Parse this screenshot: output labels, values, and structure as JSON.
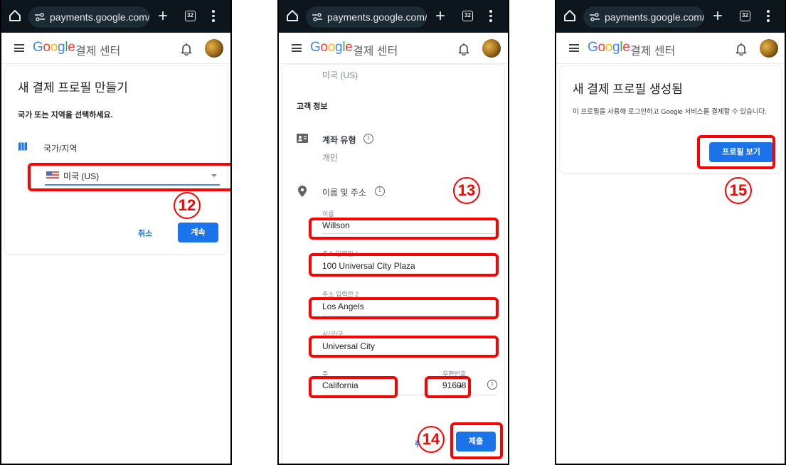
{
  "browser": {
    "url": "payments.google.com/g",
    "tab_count": "32",
    "icons": [
      "home-icon",
      "site-settings-icon",
      "new-tab-icon",
      "tab-switcher-icon",
      "more-menu-icon"
    ]
  },
  "app_header": {
    "logo_letters": [
      "G",
      "o",
      "o",
      "g",
      "l",
      "e"
    ],
    "logo_colors": [
      "#4285f4",
      "#ea4335",
      "#fbbc05",
      "#4285f4",
      "#34a853",
      "#ea4335"
    ],
    "subtitle": "결제 센터",
    "icons": [
      "menu-icon",
      "notifications-bell-icon",
      "account-avatar"
    ]
  },
  "panel1": {
    "title": "새 결제 프로필 만들기",
    "subtitle": "국가 또는 지역을 선택하세요.",
    "country_label": "국가/지역",
    "country_value": "미국 (US)",
    "cancel_label": "취소",
    "continue_label": "계속",
    "step_number": "12"
  },
  "panel2": {
    "country_value": "미국 (US)",
    "section_title": "고객 정보",
    "account_type_label": "계좌 유형",
    "account_type_value": "개인",
    "name_address_label": "이름 및 주소",
    "fields": {
      "name": {
        "label": "이름",
        "value": "Willson"
      },
      "address1": {
        "label": "주소 입력란 1",
        "value": "100 Universal City Plaza"
      },
      "address2": {
        "label": "주소 입력란 2",
        "value": "Los Angels"
      },
      "city": {
        "label": "시/군/구",
        "value": "Universal City"
      },
      "state": {
        "label": "주",
        "value": "California"
      },
      "zip": {
        "label": "우편번호",
        "value": "91608"
      }
    },
    "cancel_label": "취소",
    "submit_label": "제출",
    "step_number_fields": "13",
    "step_number_submit": "14"
  },
  "panel3": {
    "title": "새 결제 프로필 생성됨",
    "description": "이 프로필을 사용해 로그인하고 Google 서비스를 결제할 수 있습니다.",
    "view_profile_label": "프로필 보기",
    "step_number": "15"
  },
  "colors": {
    "primary": "#1a73e8",
    "annotation": "#ff0000",
    "browser_bar": "#0d161d"
  }
}
